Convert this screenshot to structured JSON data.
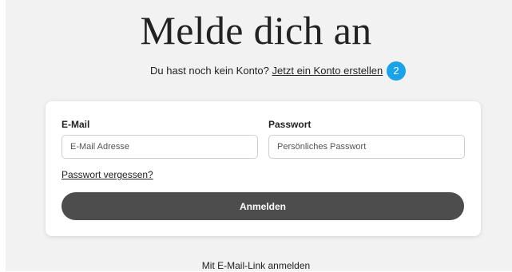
{
  "page": {
    "title": "Melde dich an",
    "subline_text": "Du hast noch kein Konto?",
    "signup_link": "Jetzt ein Konto erstellen",
    "step_badge": "2"
  },
  "form": {
    "email_label": "E-Mail",
    "email_value": "",
    "email_placeholder": "E-Mail Adresse",
    "password_label": "Passwort",
    "password_value": "",
    "password_placeholder": "Persönliches Passwort",
    "forgot_password": "Passwort vergessen?",
    "submit_label": "Anmelden"
  },
  "footer": {
    "email_link_login": "Mit E-Mail-Link anmelden"
  },
  "colors": {
    "background": "#f2f2f2",
    "card": "#ffffff",
    "button": "#4d4d4d",
    "badge": "#1aa3e8"
  }
}
